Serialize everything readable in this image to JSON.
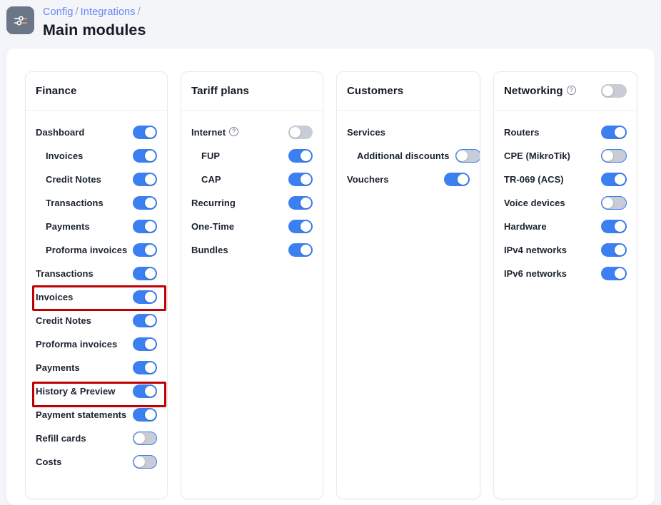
{
  "header": {
    "icon": "sliders-icon",
    "breadcrumb": [
      {
        "label": "Config",
        "link": true
      },
      {
        "label": "/",
        "link": false
      },
      {
        "label": "Integrations",
        "link": true
      },
      {
        "label": "/",
        "link": false
      }
    ],
    "breadcrumb_text": "Config / Integrations /",
    "title": "Main modules"
  },
  "colors": {
    "page_bg": "#f3f5f9",
    "toggle_on": "#3b7ff0",
    "toggle_off_track": "#c7ccd6",
    "annotation": "#c00000",
    "breadcrumb_link": "#6b86f7",
    "icon_tile": "#6b7688"
  },
  "cards": [
    {
      "id": "finance",
      "title": "Finance",
      "header_toggle": null,
      "rows": [
        {
          "label": "Dashboard",
          "state": "on",
          "indent": false,
          "help": false
        },
        {
          "label": "Invoices",
          "state": "on",
          "indent": true,
          "help": false
        },
        {
          "label": "Credit Notes",
          "state": "on",
          "indent": true,
          "help": false
        },
        {
          "label": "Transactions",
          "state": "on",
          "indent": true,
          "help": false
        },
        {
          "label": "Payments",
          "state": "on",
          "indent": true,
          "help": false
        },
        {
          "label": "Proforma invoices",
          "state": "on",
          "indent": true,
          "help": false,
          "highlighted": true
        },
        {
          "label": "Transactions",
          "state": "on",
          "indent": false,
          "help": false
        },
        {
          "label": "Invoices",
          "state": "on",
          "indent": false,
          "help": false
        },
        {
          "label": "Credit Notes",
          "state": "on",
          "indent": false,
          "help": false
        },
        {
          "label": "Proforma invoices",
          "state": "on",
          "indent": false,
          "help": false,
          "highlighted": true
        },
        {
          "label": "Payments",
          "state": "on",
          "indent": false,
          "help": false
        },
        {
          "label": "History & Preview",
          "state": "on",
          "indent": false,
          "help": false
        },
        {
          "label": "Payment statements",
          "state": "on",
          "indent": false,
          "help": false
        },
        {
          "label": "Refill cards",
          "state": "off",
          "indent": false,
          "help": false
        },
        {
          "label": "Costs",
          "state": "off",
          "indent": false,
          "help": false
        }
      ]
    },
    {
      "id": "tariff-plans",
      "title": "Tariff plans",
      "header_toggle": null,
      "rows": [
        {
          "label": "Internet",
          "state": "off-plain",
          "indent": false,
          "help": true
        },
        {
          "label": "FUP",
          "state": "on",
          "indent": true,
          "help": false
        },
        {
          "label": "CAP",
          "state": "on",
          "indent": true,
          "help": false
        },
        {
          "label": "Recurring",
          "state": "on",
          "indent": false,
          "help": false
        },
        {
          "label": "One-Time",
          "state": "on",
          "indent": false,
          "help": false
        },
        {
          "label": "Bundles",
          "state": "on",
          "indent": false,
          "help": false
        }
      ]
    },
    {
      "id": "customers",
      "title": "Customers",
      "header_toggle": null,
      "rows": [
        {
          "label": "Services",
          "state": "none",
          "indent": false,
          "help": false
        },
        {
          "label": "Additional discounts",
          "state": "off",
          "indent": true,
          "help": false
        },
        {
          "label": "Vouchers",
          "state": "on",
          "indent": false,
          "help": false
        }
      ]
    },
    {
      "id": "networking",
      "title": "Networking",
      "header_help": true,
      "header_toggle": "off-plain",
      "rows": [
        {
          "label": "Routers",
          "state": "on",
          "indent": false,
          "help": false
        },
        {
          "label": "CPE (MikroTik)",
          "state": "off",
          "indent": false,
          "help": false
        },
        {
          "label": "TR-069 (ACS)",
          "state": "on",
          "indent": false,
          "help": false
        },
        {
          "label": "Voice devices",
          "state": "off",
          "indent": false,
          "help": false
        },
        {
          "label": "Hardware",
          "state": "on",
          "indent": false,
          "help": false
        },
        {
          "label": "IPv4 networks",
          "state": "on",
          "indent": false,
          "help": false
        },
        {
          "label": "IPv6 networks",
          "state": "on",
          "indent": false,
          "help": false
        }
      ]
    }
  ],
  "annotations": [
    {
      "target": "finance.rows.5",
      "label": "Proforma invoices"
    },
    {
      "target": "finance.rows.9",
      "label": "Proforma invoices"
    }
  ],
  "help_glyph": "?"
}
